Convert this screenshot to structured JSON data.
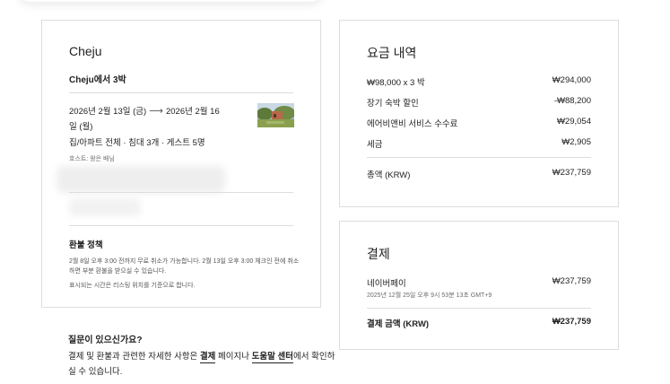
{
  "trip": {
    "city": "Cheju",
    "title": "Cheju에서 3박",
    "date_range": {
      "checkin": "2026년 2월 13일 (금)",
      "checkout_line1": "2026년 2월 16",
      "checkout_line2": "일 (월)"
    },
    "home_type": "집/아파트 전체 · 침대 3개 · 게스트 5명",
    "host": "호스트: 왕은 배님",
    "refund_policy": {
      "title": "환불 정책",
      "text": "2월 8일 오후 3:00 전까지 무료 취소가 가능합니다. 2월 13일 오후 3:00 체크인 전에 취소하면 부분 환불을 받으실 수 있습니다.",
      "note": "표시되는 시간은 리스팅 위치를 기준으로 합니다."
    }
  },
  "price_details": {
    "heading": "요금 내역",
    "rows": [
      {
        "label": "₩98,000 x 3 박",
        "value": "₩294,000"
      },
      {
        "label": "장기 숙박 할인",
        "value": "-₩88,200"
      },
      {
        "label": "에어비앤비 서비스 수수료",
        "value": "₩29,054"
      },
      {
        "label": "세금",
        "value": "₩2,905"
      }
    ],
    "total": {
      "label": "총액 (KRW)",
      "value": "₩237,759"
    }
  },
  "payment": {
    "heading": "결제",
    "method": "네이버페이",
    "amount": "₩237,759",
    "date": "2025년 12월 25일 오후 9시 53분 13초 GMT+9",
    "total": {
      "label": "결제 금액 (KRW)",
      "value": "₩237,759"
    }
  },
  "faq": {
    "title": "질문이 있으신가요?",
    "text_before": "결제 및 환불과 관련한 자세한 사항은 ",
    "link1": "결제",
    "text_middle": " 페이지나 ",
    "link2": "도움말 센터",
    "text_after": "에서 확인하실 수 있습니다."
  }
}
